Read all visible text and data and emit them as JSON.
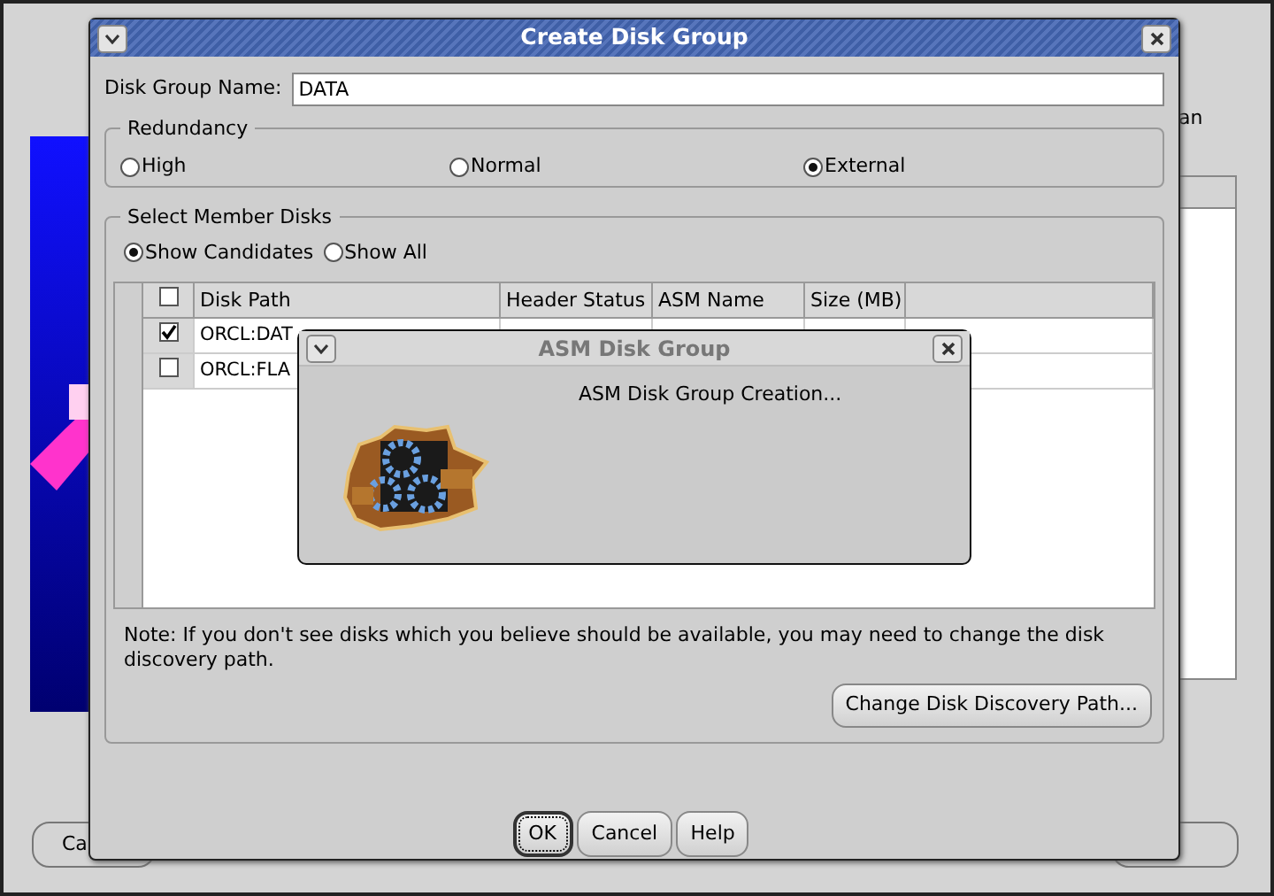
{
  "background_window": {
    "side_label": "an",
    "buttons": [
      "Ca"
    ]
  },
  "dialog": {
    "title": "Create Disk Group",
    "name_label": "Disk Group Name:",
    "name_value": "DATA",
    "redundancy": {
      "legend": "Redundancy",
      "options": [
        {
          "label": "High",
          "selected": false
        },
        {
          "label": "Normal",
          "selected": false
        },
        {
          "label": "External",
          "selected": true
        }
      ]
    },
    "member_disks": {
      "legend": "Select Member Disks",
      "filters": [
        {
          "label": "Show Candidates",
          "selected": true
        },
        {
          "label": "Show All",
          "selected": false
        }
      ],
      "table": {
        "header_checked": false,
        "columns": [
          "Disk Path",
          "Header Status",
          "ASM Name",
          "Size (MB)"
        ],
        "rows": [
          {
            "checked": true,
            "disk_path": "ORCL:DAT"
          },
          {
            "checked": false,
            "disk_path": "ORCL:FLA"
          }
        ]
      },
      "note": "Note: If you don't see disks which you believe should be available, you may need to change the disk discovery path.",
      "discovery_button": "Change Disk Discovery Path..."
    },
    "buttons": [
      {
        "label": "OK",
        "focused": true
      },
      {
        "label": "Cancel",
        "focused": false
      },
      {
        "label": "Help",
        "focused": false
      }
    ]
  },
  "progress_popup": {
    "title": "ASM Disk Group",
    "message": "ASM Disk Group Creation..."
  }
}
